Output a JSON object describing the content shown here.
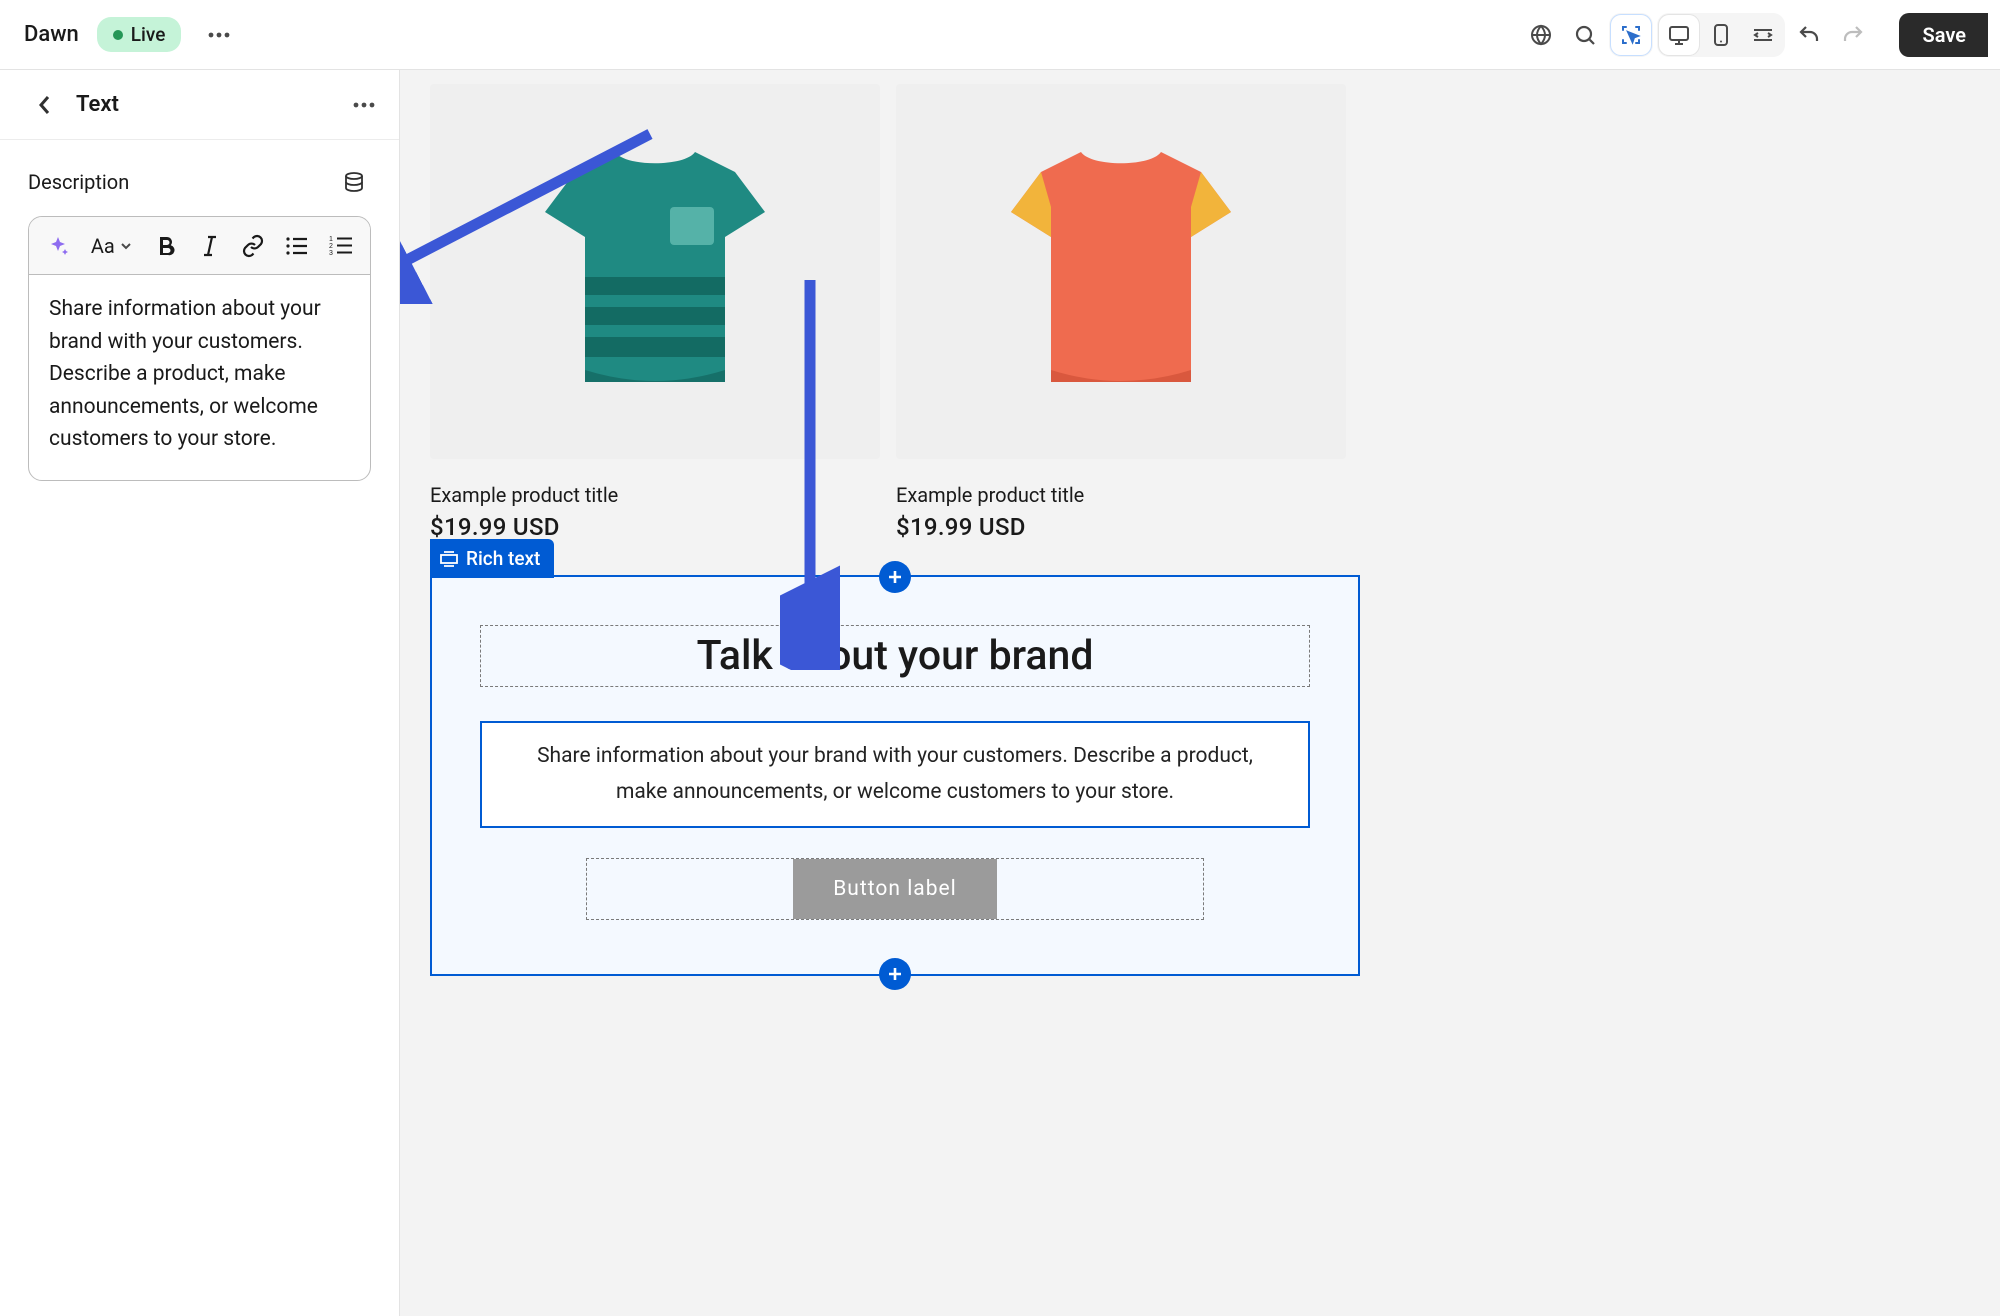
{
  "topbar": {
    "theme_name": "Dawn",
    "status": "Live",
    "save": "Save"
  },
  "sidebar": {
    "panel_title": "Text",
    "field_label": "Description",
    "format_label": "Aa",
    "rte_content": "Share information about your brand with your customers. Describe a product, make announcements, or welcome customers to your store."
  },
  "canvas": {
    "products": [
      {
        "title": "Example product title",
        "price": "$19.99 USD",
        "shirt_color": "teal"
      },
      {
        "title": "Example product title",
        "price": "$19.99 USD",
        "shirt_color": "orange"
      }
    ],
    "section_tag": "Rich text",
    "heading": "Talk about your brand",
    "paragraph": "Share information about your brand with your customers. Describe a product, make announcements, or welcome customers to your store.",
    "button": "Button label"
  }
}
